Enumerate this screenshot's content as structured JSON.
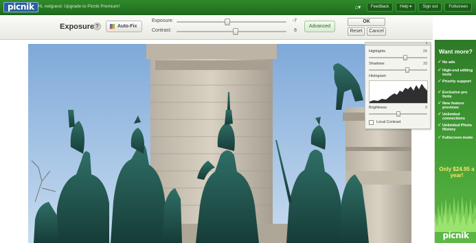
{
  "app": {
    "logo": "picnik",
    "greeting": "Hi, netguest: Upgrade to Picnik Premium!",
    "nav": [
      "Feedback",
      "Help ▾",
      "Sign out",
      "Fullscreen"
    ]
  },
  "tool": {
    "title": "Exposure",
    "help": "?",
    "autofix": "Auto-Fix",
    "exposure": {
      "label": "Exposure:",
      "value": "-7",
      "level": 0.46
    },
    "contrast": {
      "label": "Contrast:",
      "value": "6",
      "level": 0.54
    },
    "advanced": "Advanced",
    "ok": "OK",
    "reset": "Reset",
    "cancel": "Cancel"
  },
  "advanced_panel": {
    "highlights": {
      "label": "Highlights",
      "value": "29",
      "level": 0.62
    },
    "shadows": {
      "label": "Shadows",
      "value": "33",
      "level": 0.66
    },
    "histogram_label": "Histogram",
    "brightness": {
      "label": "Brightness",
      "value": "0",
      "level": 0.5
    },
    "local_contrast": "Local Contrast"
  },
  "ad": {
    "title": "Want more?",
    "items": [
      "No ads",
      "High-end editing tools",
      "Priority support",
      "Exclusive pro fonts",
      "New feature previews",
      "Unlimited connections",
      "Unlimited Photo History",
      "Fullscreen mode"
    ],
    "price": "Only $24.95 a year!",
    "logo": "picnik"
  },
  "colors": {
    "brand_green": "#2f8a2b",
    "logo_blue": "#2a5f9e",
    "accent": "#ffe66b"
  }
}
